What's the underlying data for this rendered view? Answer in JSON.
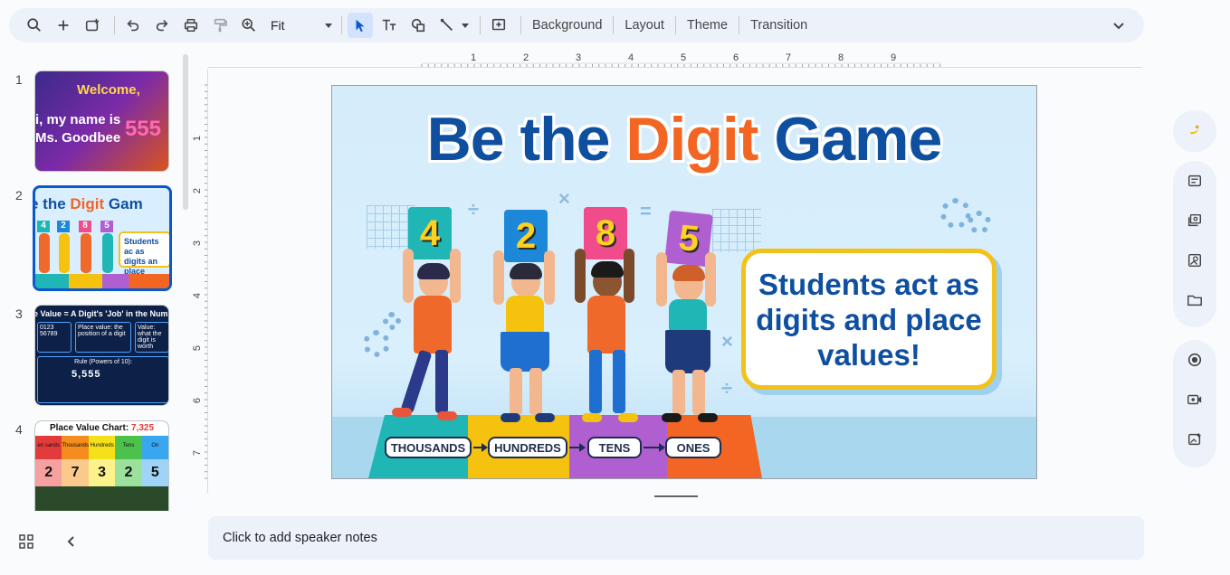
{
  "toolbar": {
    "zoom_value": "Fit",
    "background_label": "Background",
    "layout_label": "Layout",
    "theme_label": "Theme",
    "transition_label": "Transition"
  },
  "filmstrip": {
    "slides": [
      {
        "number": "1",
        "welcome": "Welcome,",
        "line2": "i, my name is",
        "line3": "Ms. Goodbee",
        "digits": "555"
      },
      {
        "number": "2",
        "title_a": "e the ",
        "title_b": "Digit",
        "title_c": " Gam",
        "cards": [
          "4",
          "2",
          "8",
          "5"
        ],
        "callout": "Students ac as digits an place value"
      },
      {
        "number": "3",
        "heading": "e Value = A Digit's 'Job' in the Num",
        "p1": "0123 56789",
        "p2": "Place value: the position of a digit",
        "p3": "Value: what the digit is worth",
        "rule": "Rule (Powers of 10):",
        "num": "5,555"
      },
      {
        "number": "4",
        "heading_a": "Place Value Chart: ",
        "heading_b": "7,325",
        "cols": [
          "en sands",
          "Thousands",
          "Hundreds",
          "Tens",
          "On"
        ],
        "digits": [
          "2",
          "7",
          "3",
          "2",
          "5"
        ]
      }
    ]
  },
  "ruler": {
    "h": [
      "1",
      "2",
      "3",
      "4",
      "5",
      "6",
      "7",
      "8",
      "9"
    ],
    "v": [
      "1",
      "2",
      "3",
      "4",
      "5",
      "6",
      "7"
    ]
  },
  "slide": {
    "title_part1": "Be the ",
    "title_accent": "Digit",
    "title_part2": " Game",
    "cards": [
      "4",
      "2",
      "8",
      "5"
    ],
    "callout": "Students act as digits and place values!",
    "steps": [
      "THOUSANDS",
      "HUNDREDS",
      "TENS",
      "ONES"
    ]
  },
  "notes": {
    "placeholder": "Click to add speaker notes"
  },
  "colors": {
    "brand_blue": "#0e4fa0",
    "accent_orange": "#f26522",
    "selection_blue": "#0b57d0"
  }
}
